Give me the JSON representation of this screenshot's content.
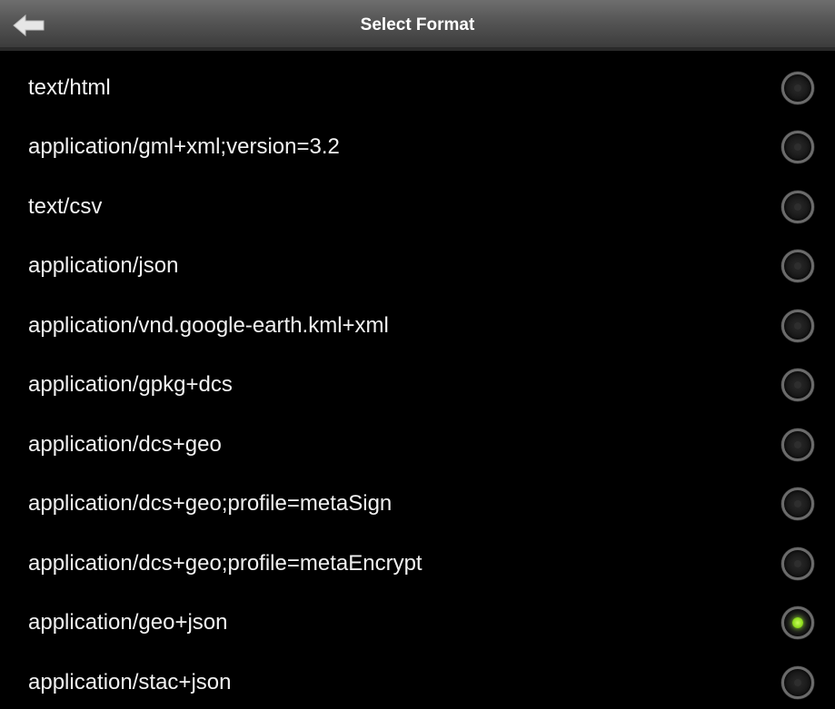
{
  "header": {
    "title": "Select Format",
    "back_icon": "back-arrow-icon"
  },
  "formats": [
    {
      "label": "text/html",
      "selected": false
    },
    {
      "label": "application/gml+xml;version=3.2",
      "selected": false
    },
    {
      "label": "text/csv",
      "selected": false
    },
    {
      "label": "application/json",
      "selected": false
    },
    {
      "label": "application/vnd.google-earth.kml+xml",
      "selected": false
    },
    {
      "label": "application/gpkg+dcs",
      "selected": false
    },
    {
      "label": "application/dcs+geo",
      "selected": false
    },
    {
      "label": "application/dcs+geo;profile=metaSign",
      "selected": false
    },
    {
      "label": "application/dcs+geo;profile=metaEncrypt",
      "selected": false
    },
    {
      "label": "application/geo+json",
      "selected": true
    },
    {
      "label": "application/stac+json",
      "selected": false
    }
  ],
  "colors": {
    "background": "#000000",
    "text": "#f2f2f2",
    "selected_indicator": "#8fdc1e"
  }
}
